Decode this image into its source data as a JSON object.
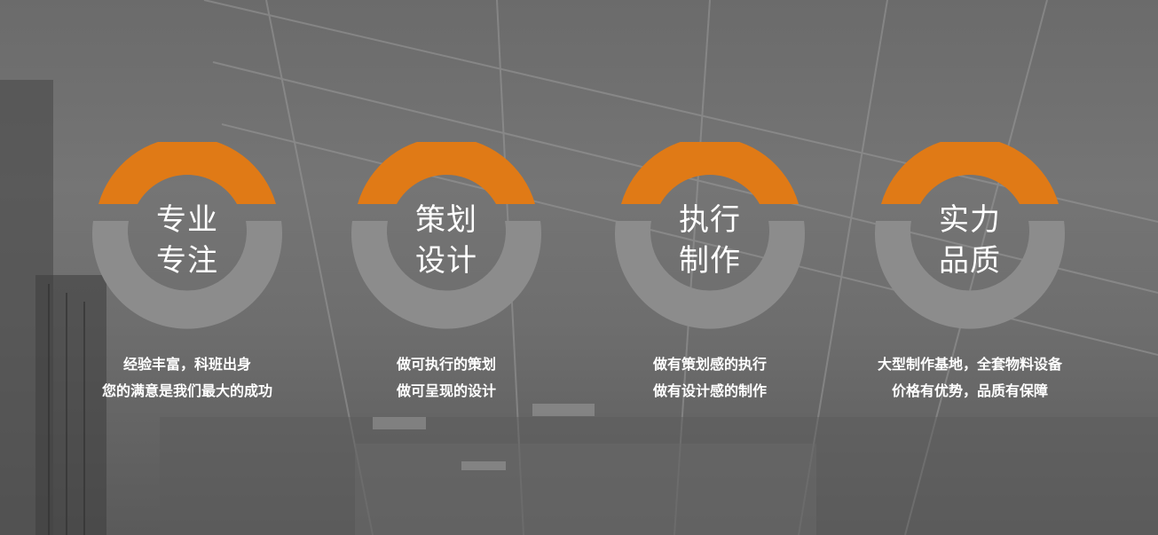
{
  "colors": {
    "accent": "#e07a16",
    "ring_gray": "#8c8c8c",
    "text": "#ffffff"
  },
  "features": [
    {
      "title": [
        "专业",
        "专注"
      ],
      "desc": [
        "经验丰富，科班出身",
        "您的满意是我们最大的成功"
      ]
    },
    {
      "title": [
        "策划",
        "设计"
      ],
      "desc": [
        "做可执行的策划",
        "做可呈现的设计"
      ]
    },
    {
      "title": [
        "执行",
        "制作"
      ],
      "desc": [
        "做有策划感的执行",
        "做有设计感的制作"
      ]
    },
    {
      "title": [
        "实力",
        "品质"
      ],
      "desc": [
        "大型制作基地，全套物料设备",
        "价格有优势，品质有保障"
      ]
    }
  ]
}
